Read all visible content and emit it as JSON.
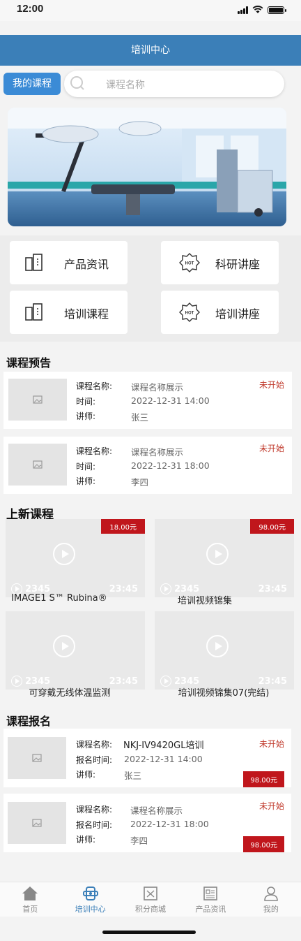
{
  "status_bar": {
    "time": "12:00"
  },
  "header": {
    "title": "培训中心"
  },
  "search": {
    "my_course_label": "我的课程",
    "placeholder": "课程名称"
  },
  "quick_links": [
    {
      "label": "产品资讯",
      "icon": "product-info-icon"
    },
    {
      "label": "科研讲座",
      "icon": "hot-badge-icon"
    },
    {
      "label": "培训课程",
      "icon": "training-course-icon"
    },
    {
      "label": "培训讲座",
      "icon": "hot-badge-icon"
    }
  ],
  "preview": {
    "title": "课程预告",
    "items": [
      {
        "name_label": "课程名称:",
        "name": "课程名称展示",
        "time_label": "时间:",
        "time": "2022-12-31 14:00",
        "lecturer_label": "讲师:",
        "lecturer": "张三",
        "status": "未开始"
      },
      {
        "name_label": "课程名称:",
        "name": "课程名称展示",
        "time_label": "时间:",
        "time": "2022-12-31 18:00",
        "lecturer_label": "讲师:",
        "lecturer": "李四",
        "status": "未开始"
      }
    ]
  },
  "new_courses": {
    "title": "上新课程",
    "items": [
      {
        "title": "IMAGE1 S™ Rubina®",
        "views": "2345",
        "duration": "23:45",
        "price": "18.00元"
      },
      {
        "title": "培训视频锦集",
        "views": "2345",
        "duration": "23:45",
        "price": "98.00元"
      },
      {
        "title": "可穿戴无线体温监测",
        "views": "2345",
        "duration": "23:45",
        "price": ""
      },
      {
        "title": "培训视频锦集07(完结)",
        "views": "2345",
        "duration": "23:45",
        "price": ""
      }
    ]
  },
  "enrollment": {
    "title": "课程报名",
    "items": [
      {
        "name_label": "课程名称:",
        "name": "NKJ-IV9420GL培训",
        "time_label": "报名时间:",
        "time": "2022-12-31 14:00",
        "lecturer_label": "讲师:",
        "lecturer": "张三",
        "status": "未开始",
        "price": "98.00元"
      },
      {
        "name_label": "课程名称:",
        "name": "课程名称展示",
        "time_label": "报名时间:",
        "time": "2022-12-31 18:00",
        "lecturer_label": "讲师:",
        "lecturer": "李四",
        "status": "未开始",
        "price": "98.00元"
      }
    ]
  },
  "tabbar": [
    {
      "label": "首页",
      "icon": "home-icon",
      "active": false
    },
    {
      "label": "培训中心",
      "icon": "training-center-icon",
      "active": true
    },
    {
      "label": "积分商城",
      "icon": "points-mall-icon",
      "active": false
    },
    {
      "label": "产品资讯",
      "icon": "news-icon",
      "active": false
    },
    {
      "label": "我的",
      "icon": "profile-icon",
      "active": false
    }
  ],
  "colors": {
    "header": "#3b7fb8",
    "accent_blue": "#3b8bd6",
    "price_red": "#c0161c",
    "status_red": "#c0392b"
  }
}
